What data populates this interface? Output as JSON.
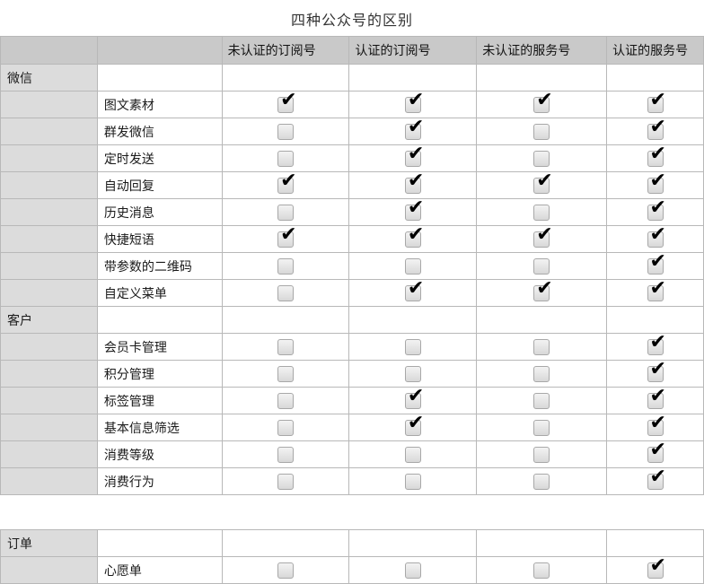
{
  "title": "四种公众号的区别",
  "columns": [
    "",
    "",
    "未认证的订阅号",
    "认证的订阅号",
    "未认证的服务号",
    "认证的服务号"
  ],
  "sections": [
    {
      "name": "微信",
      "rows": [
        {
          "label": "图文素材",
          "checks": [
            true,
            true,
            true,
            true
          ]
        },
        {
          "label": "群发微信",
          "checks": [
            false,
            true,
            false,
            true
          ]
        },
        {
          "label": "定时发送",
          "checks": [
            false,
            true,
            false,
            true
          ]
        },
        {
          "label": "自动回复",
          "checks": [
            true,
            true,
            true,
            true
          ]
        },
        {
          "label": "历史消息",
          "checks": [
            false,
            true,
            false,
            true
          ]
        },
        {
          "label": "快捷短语",
          "checks": [
            true,
            true,
            true,
            true
          ]
        },
        {
          "label": "带参数的二维码",
          "checks": [
            false,
            false,
            false,
            true
          ]
        },
        {
          "label": "自定义菜单",
          "checks": [
            false,
            true,
            true,
            true
          ]
        }
      ]
    },
    {
      "name": "客户",
      "rows": [
        {
          "label": "会员卡管理",
          "checks": [
            false,
            false,
            false,
            true
          ]
        },
        {
          "label": "积分管理",
          "checks": [
            false,
            false,
            false,
            true
          ]
        },
        {
          "label": "标签管理",
          "checks": [
            false,
            true,
            false,
            true
          ]
        },
        {
          "label": "基本信息筛选",
          "checks": [
            false,
            true,
            false,
            true
          ]
        },
        {
          "label": "消费等级",
          "checks": [
            false,
            false,
            false,
            true
          ]
        },
        {
          "label": "消费行为",
          "checks": [
            false,
            false,
            false,
            true
          ]
        }
      ]
    }
  ],
  "orders": {
    "name": "订单",
    "rows": [
      {
        "label": "心愿单",
        "checks": [
          false,
          false,
          false,
          true
        ]
      }
    ]
  },
  "glyphs": {
    "check": "✔"
  }
}
